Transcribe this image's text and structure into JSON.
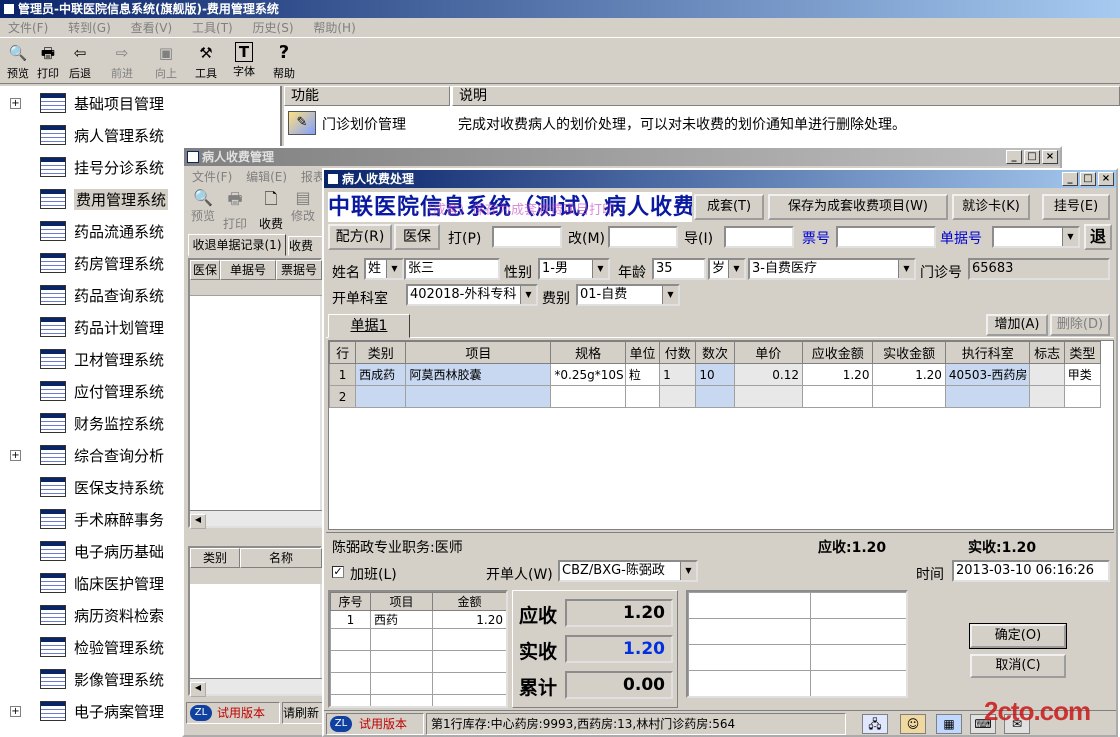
{
  "main_window": {
    "title": "管理员-中联医院信息系统(旗舰版)-费用管理系统"
  },
  "menu": [
    "文件(F)",
    "转到(G)",
    "查看(V)",
    "工具(T)",
    "历史(S)",
    "帮助(H)"
  ],
  "toolbar": [
    {
      "label": "预览",
      "icon": "preview-icon",
      "glyph": "🔍"
    },
    {
      "label": "打印",
      "icon": "printer-icon",
      "glyph": "🖶"
    },
    {
      "label": "后退",
      "icon": "back-arrow-icon",
      "glyph": "⇦"
    },
    {
      "label": "前进",
      "icon": "forward-arrow-icon",
      "glyph": "⇨"
    },
    {
      "label": "向上",
      "icon": "up-folder-icon",
      "glyph": "▣"
    },
    {
      "label": "工具",
      "icon": "tools-icon",
      "glyph": "⚒"
    },
    {
      "label": "字体",
      "icon": "font-icon",
      "glyph": "T"
    },
    {
      "label": "帮助",
      "icon": "help-icon",
      "glyph": "?"
    }
  ],
  "tree": [
    {
      "label": "基础项目管理",
      "expandable": true
    },
    {
      "label": "病人管理系统",
      "expandable": false
    },
    {
      "label": "挂号分诊系统",
      "expandable": false
    },
    {
      "label": "费用管理系统",
      "expandable": false,
      "selected": true
    },
    {
      "label": "药品流通系统",
      "expandable": false
    },
    {
      "label": "药房管理系统",
      "expandable": false
    },
    {
      "label": "药品查询系统",
      "expandable": false
    },
    {
      "label": "药品计划管理",
      "expandable": false
    },
    {
      "label": "卫材管理系统",
      "expandable": false
    },
    {
      "label": "应付管理系统",
      "expandable": false
    },
    {
      "label": "财务监控系统",
      "expandable": false
    },
    {
      "label": "综合查询分析",
      "expandable": true
    },
    {
      "label": "医保支持系统",
      "expandable": false
    },
    {
      "label": "手术麻醉事务",
      "expandable": false
    },
    {
      "label": "电子病历基础",
      "expandable": false
    },
    {
      "label": "临床医护管理",
      "expandable": false
    },
    {
      "label": "病历资料检索",
      "expandable": false
    },
    {
      "label": "检验管理系统",
      "expandable": false
    },
    {
      "label": "影像管理系统",
      "expandable": false
    },
    {
      "label": "电子病案管理",
      "expandable": true
    }
  ],
  "func_list": {
    "col_function": "功能",
    "col_desc": "说明",
    "row": {
      "name": "门诊划价管理",
      "desc": "完成对收费病人的划价处理，可以对未收费的划价通知单进行删除处理。"
    }
  },
  "mgmt_window": {
    "title": "病人收费管理",
    "menu": [
      "文件(F)",
      "编辑(E)",
      "报表"
    ],
    "tools": [
      "预览",
      "打印",
      "收费",
      "修改"
    ],
    "tab1": "收退单据记录(1)",
    "tab2": "收费",
    "grid_cols": [
      "医保",
      "单据号",
      "票据号"
    ],
    "grid2_cols": [
      "类别",
      "名称"
    ],
    "trial": "试用版本",
    "refresh": "请刷新"
  },
  "proc_window": {
    "title": "病人收费处理",
    "banner": "中联医院信息系统（测试）病人收费处理",
    "watermark": "（成套）保存为成套收费项目打印",
    "buttons": {
      "set": "成套(T)",
      "save_set": "保存为成套收费项目(W)",
      "card": "就诊卡(K)",
      "register": "挂号(E)",
      "recipe": "配方(R)",
      "insurance": "医保",
      "back": "退",
      "add": "增加(A)",
      "del": "删除(D)",
      "ok": "确定(O)",
      "cancel": "取消(C)"
    },
    "labels": {
      "print": "打(P)",
      "change": "改(M)",
      "guide": "导(I)",
      "ticket_no": "票号",
      "bill_no": "单据号",
      "name": "姓名",
      "sex": "性别",
      "age": "年龄",
      "outpatient_no": "门诊号",
      "dept": "开单科室",
      "fee_type": "费别",
      "bill_tab": "单据1",
      "overtime": "加班(L)",
      "issuer": "开单人(W)",
      "time": "时间",
      "receivable": "应收",
      "received": "实收",
      "total": "累计"
    },
    "patient": {
      "surname": "姓",
      "name": "张三",
      "sex": "1-男",
      "age": "35",
      "age_unit": "岁",
      "payment": "3-自费医疗",
      "outpatient_no": "65683",
      "dept": "402018-外科专科",
      "fee_type": "01-自费"
    },
    "items_cols": [
      "行",
      "类别",
      "项目",
      "规格",
      "单位",
      "付数",
      "数次",
      "单价",
      "应收金额",
      "实收金额",
      "执行科室",
      "标志",
      "类型"
    ],
    "items_rows": [
      {
        "row": "1",
        "cat": "西成药",
        "item": "阿莫西林胶囊",
        "spec": "*0.25g*10S",
        "unit": "粒",
        "pays": "1",
        "times": "10",
        "price": "0.12",
        "recv": "1.20",
        "real": "1.20",
        "dept": "40503-西药房",
        "flag": "",
        "type": "甲类"
      },
      {
        "row": "2",
        "cat": "",
        "item": "",
        "spec": "",
        "unit": "",
        "pays": "",
        "times": "",
        "price": "",
        "recv": "",
        "real": "",
        "dept": "",
        "flag": "",
        "type": ""
      }
    ],
    "doctor_info": "陈弼政专业职务:医师",
    "sum_receivable": "应收:1.20",
    "sum_received": "实收:1.20",
    "issuer_value": "CBZ/BXG-陈弼政",
    "time_value": "2013-03-10 06:16:26",
    "summary_cols": [
      "序号",
      "项目",
      "金额"
    ],
    "summary_rows": [
      {
        "no": "1",
        "item": "西药",
        "amount": "1.20"
      }
    ],
    "amounts": {
      "receivable": "1.20",
      "received": "1.20",
      "total": "0.00"
    },
    "status": {
      "trial": "试用版本",
      "stock": "第1行库存:中心药房:9993,西药房:13,林村门诊药房:564"
    }
  },
  "watermark_site": "2cto.com"
}
